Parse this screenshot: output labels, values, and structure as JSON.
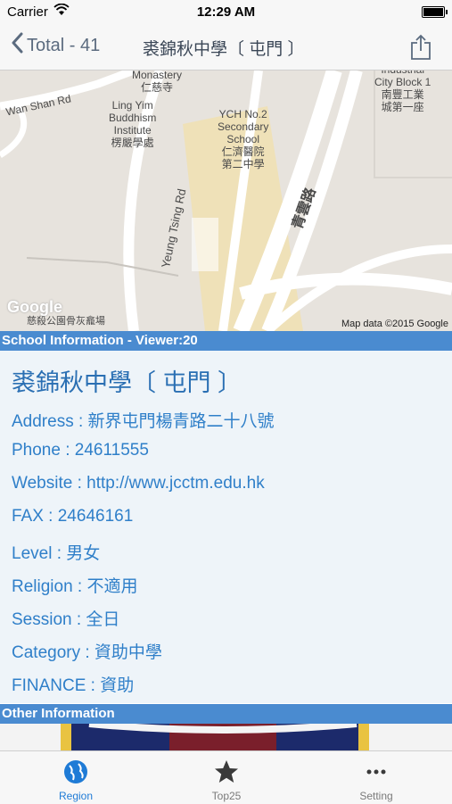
{
  "status": {
    "carrier": "Carrier",
    "time": "12:29 AM"
  },
  "nav": {
    "back_label": "Total - 41",
    "title": "裘錦秋中學〔 屯門 〕"
  },
  "map": {
    "labels": {
      "monastery": "Monastery\n仁慈寺",
      "wan_shan": "Wan Shan Rd",
      "ling_yim": "Ling Yim\nBuddhism\nInstitute\n楞嚴學處",
      "ych": "YCH No.2\nSecondary\nSchool\n仁濟醫院\n第二中學",
      "industrial": "Industrial\nCity Block 1\n南豐工業\n城第一座",
      "yeung_tsing": "Yeung Tsing Rd",
      "ching_wan": "青雲路",
      "cemetery": "慈殺公園骨灰龕場",
      "google": "Google",
      "map_data": "Map data ©2015 Google"
    }
  },
  "school_info": {
    "header": "School Information - Viewer:20",
    "name": "裘錦秋中學〔 屯門 〕",
    "address": "Address : 新界屯門楊青路二十八號",
    "phone": "Phone : 24611555",
    "website": "Website : http://www.jcctm.edu.hk",
    "fax": "FAX : 24646161",
    "level": "Level : 男女",
    "religion": "Religion : 不適用",
    "session": "Session : 全日",
    "category": "Category : 資助中學",
    "finance": "FINANCE : 資助"
  },
  "other": {
    "header": "Other Information"
  },
  "tabs": [
    {
      "label": "Region",
      "icon": "globe-icon"
    },
    {
      "label": "Top25",
      "icon": "star-icon"
    },
    {
      "label": "Setting",
      "icon": "more-icon"
    }
  ],
  "colors": {
    "accent": "#2f7fc9",
    "section": "#4a8bd0",
    "tab_active": "#1f7bd6",
    "tab_inactive": "#7a7a7a"
  }
}
